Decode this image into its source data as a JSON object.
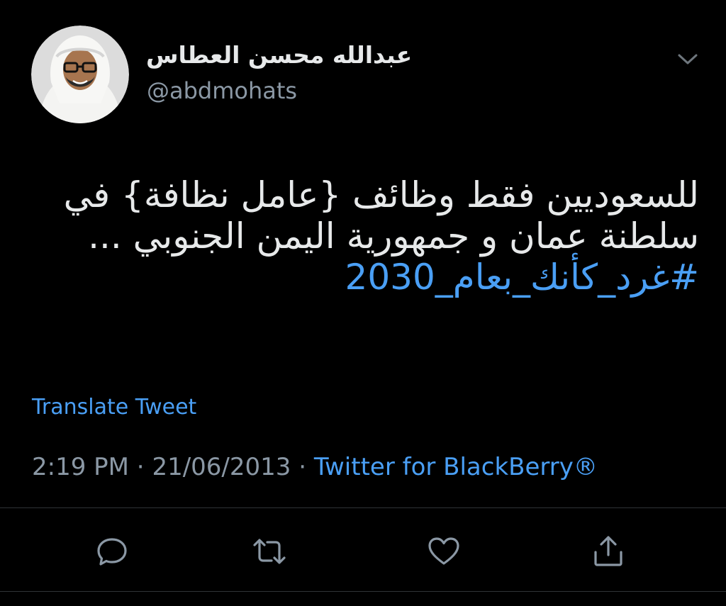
{
  "user": {
    "display_name": "عبدالله محسن العطاس",
    "handle": "@abdmohats",
    "avatar_icon": "profile-photo"
  },
  "tweet": {
    "lines": [
      "للسعوديين فقط وظائف {عامل نظافة} في",
      "سلطنة عمان و جمهورية اليمن الجنوبي ..."
    ],
    "hashtag": "#غرد_كأنك_بعام_2030"
  },
  "translate_label": "Translate Tweet",
  "meta": {
    "time": "2:19 PM",
    "separator": " · ",
    "date": "21/06/2013",
    "source": "Twitter for BlackBerry®"
  },
  "actions": [
    {
      "name": "reply",
      "icon": "speech-bubble-icon"
    },
    {
      "name": "retweet",
      "icon": "retweet-arrows-icon"
    },
    {
      "name": "like",
      "icon": "heart-icon"
    },
    {
      "name": "share",
      "icon": "share-upload-icon"
    }
  ],
  "colors": {
    "background": "#000000",
    "text": "#e7e9ea",
    "secondary": "#8b98a5",
    "link": "#4a9ff5",
    "divider": "#2f3336"
  }
}
